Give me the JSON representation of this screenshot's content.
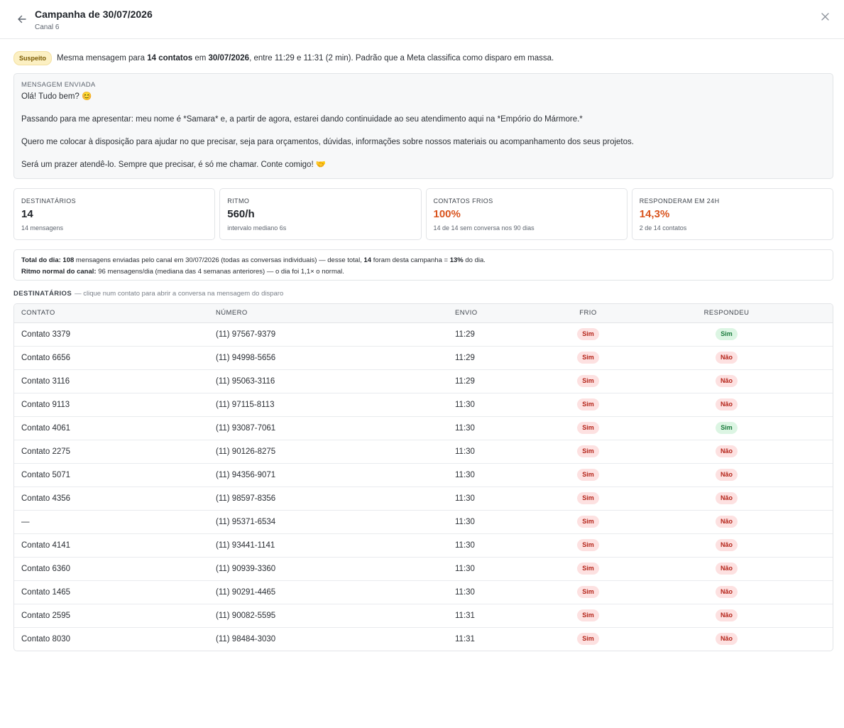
{
  "header": {
    "title": "Campanha de 30/07/2026",
    "subtitle": "Canal 6"
  },
  "alert": {
    "badge": "Suspeito",
    "t1": "Mesma mensagem para ",
    "b1": "14 contatos",
    "t2": " em ",
    "b2": "30/07/2026",
    "t3": ", entre 11:29 e 11:31 (2 min). Padrão que a Meta classifica como disparo em massa."
  },
  "message": {
    "label": "MENSAGEM ENVIADA",
    "lines": [
      "Olá! Tudo bem? 😊",
      "",
      "Passando para me apresentar: meu nome é *Samara* e, a partir de agora, estarei dando continuidade ao seu atendimento aqui na *Empório do Mármore.*",
      "",
      "Quero me colocar à disposição para ajudar no que precisar, seja para orçamentos, dúvidas, informações sobre nossos materiais ou acompanhamento dos seus projetos.",
      "",
      "Será um prazer atendê-lo. Sempre que precisar, é só me chamar. Conte comigo! 🤝"
    ]
  },
  "stats": [
    {
      "label": "DESTINATÁRIOS",
      "value": "14",
      "sub": "14 mensagens",
      "warn": false
    },
    {
      "label": "RITMO",
      "value": "560/h",
      "sub": "intervalo mediano 6s",
      "warn": false
    },
    {
      "label": "CONTATOS FRIOS",
      "value": "100%",
      "sub": "14 de 14 sem conversa nos 90 dias",
      "warn": true
    },
    {
      "label": "RESPONDERAM EM 24H",
      "value": "14,3%",
      "sub": "2 de 14 contatos",
      "warn": true
    }
  ],
  "summary": {
    "l1_bold1": "Total do dia:",
    "l1_bold2": "108",
    "l1_t1": " mensagens enviadas pelo canal em 30/07/2026 (todas as conversas individuais) — desse total, ",
    "l1_bold3": "14",
    "l1_t2": " foram desta campanha = ",
    "l1_bold4": "13%",
    "l1_t3": " do dia.",
    "l2_bold": "Ritmo normal do canal:",
    "l2_t": " 96 mensagens/dia (mediana das 4 semanas anteriores) — o dia foi 1,1× o normal."
  },
  "recipients": {
    "title": "DESTINATÁRIOS",
    "hint": "— clique num contato para abrir a conversa na mensagem do disparo",
    "columns": [
      "CONTATO",
      "NÚMERO",
      "ENVIO",
      "FRIO",
      "RESPONDEU"
    ],
    "rows": [
      {
        "contato": "Contato 3379",
        "numero": "(11) 97567-9379",
        "envio": "11:29",
        "frio": "Sim",
        "respondeu": "Sim"
      },
      {
        "contato": "Contato 6656",
        "numero": "(11) 94998-5656",
        "envio": "11:29",
        "frio": "Sim",
        "respondeu": "Não"
      },
      {
        "contato": "Contato 3116",
        "numero": "(11) 95063-3116",
        "envio": "11:29",
        "frio": "Sim",
        "respondeu": "Não"
      },
      {
        "contato": "Contato 9113",
        "numero": "(11) 97115-8113",
        "envio": "11:30",
        "frio": "Sim",
        "respondeu": "Não"
      },
      {
        "contato": "Contato 4061",
        "numero": "(11) 93087-7061",
        "envio": "11:30",
        "frio": "Sim",
        "respondeu": "Sim"
      },
      {
        "contato": "Contato 2275",
        "numero": "(11) 90126-8275",
        "envio": "11:30",
        "frio": "Sim",
        "respondeu": "Não"
      },
      {
        "contato": "Contato 5071",
        "numero": "(11) 94356-9071",
        "envio": "11:30",
        "frio": "Sim",
        "respondeu": "Não"
      },
      {
        "contato": "Contato 4356",
        "numero": "(11) 98597-8356",
        "envio": "11:30",
        "frio": "Sim",
        "respondeu": "Não"
      },
      {
        "contato": "—",
        "numero": "(11) 95371-6534",
        "envio": "11:30",
        "frio": "Sim",
        "respondeu": "Não"
      },
      {
        "contato": "Contato 4141",
        "numero": "(11) 93441-1141",
        "envio": "11:30",
        "frio": "Sim",
        "respondeu": "Não"
      },
      {
        "contato": "Contato 6360",
        "numero": "(11) 90939-3360",
        "envio": "11:30",
        "frio": "Sim",
        "respondeu": "Não"
      },
      {
        "contato": "Contato 1465",
        "numero": "(11) 90291-4465",
        "envio": "11:30",
        "frio": "Sim",
        "respondeu": "Não"
      },
      {
        "contato": "Contato 2595",
        "numero": "(11) 90082-5595",
        "envio": "11:31",
        "frio": "Sim",
        "respondeu": "Não"
      },
      {
        "contato": "Contato 8030",
        "numero": "(11) 98484-3030",
        "envio": "11:31",
        "frio": "Sim",
        "respondeu": "Não"
      }
    ]
  },
  "colors": {
    "warn": "#d9541e",
    "pill_red_bg": "#fde1e1",
    "pill_red_text": "#b42318",
    "pill_green_bg": "#dcf5e3",
    "pill_green_text": "#1a7a3c",
    "suspect_bg": "#fcf0c3"
  },
  "icons": {
    "back": "arrow-left-icon",
    "close": "close-icon"
  }
}
